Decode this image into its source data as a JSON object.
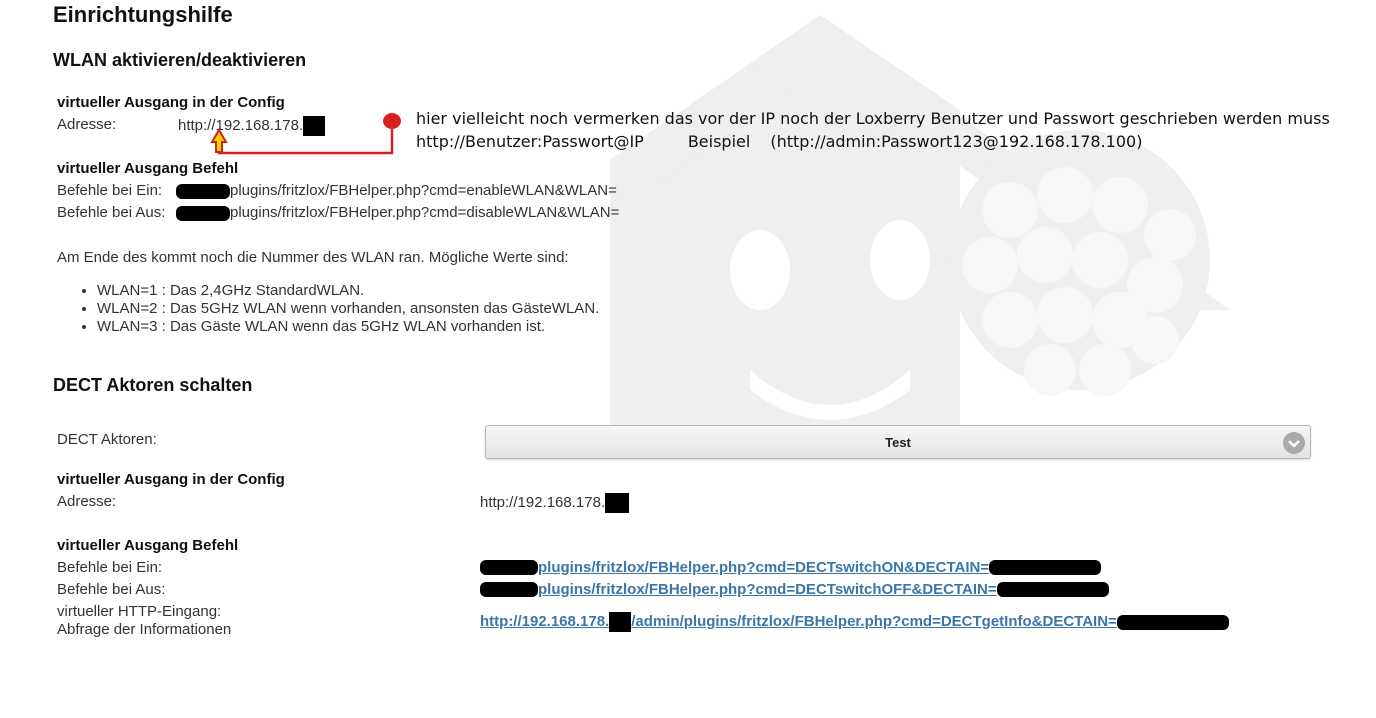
{
  "page": {
    "title": "Einrichtungshilfe"
  },
  "wlan": {
    "heading": "WLAN aktivieren/deaktivieren",
    "config_heading": "virtueller Ausgang in der Config",
    "address_label": "Adresse:",
    "address_value": "http://192.168.178.",
    "command_heading": "virtueller Ausgang Befehl",
    "on_label": "Befehle bei Ein:",
    "on_value": "plugins/fritzlox/FBHelper.php?cmd=enableWLAN&WLAN=",
    "off_label": "Befehle bei Aus:",
    "off_value": "plugins/fritzlox/FBHelper.php?cmd=disableWLAN&WLAN=",
    "info_text": "Am Ende des kommt noch die Nummer des WLAN ran. Mögliche Werte sind:",
    "options": [
      "WLAN=1 : Das 2,4GHz StandardWLAN.",
      "WLAN=2 : Das 5GHz WLAN wenn vorhanden, ansonsten das GästeWLAN.",
      "WLAN=3 : Das Gäste WLAN wenn das 5GHz WLAN vorhanden ist."
    ]
  },
  "annotation": {
    "line1": "hier vielleicht noch vermerken das vor der IP noch der Loxberry Benutzer und Passwort geschrieben werden muss",
    "line2_part1": "http://Benutzer:Passwort@IP",
    "line2_part2": "Beispiel",
    "line2_part3": "(http://admin:Passwort123@192.168.178.100)",
    "color": "#d42020"
  },
  "dect": {
    "heading": "DECT Aktoren schalten",
    "actors_label": "DECT Aktoren:",
    "actors_selected": "Test",
    "config_heading": "virtueller Ausgang in der Config",
    "address_label": "Adresse:",
    "address_value": "http://192.168.178.",
    "command_heading": "virtueller Ausgang Befehl",
    "on_label": "Befehle bei Ein:",
    "on_link": "plugins/fritzlox/FBHelper.php?cmd=DECTswitchON&DECTAIN=",
    "off_label": "Befehle bei Aus:",
    "off_link": "plugins/fritzlox/FBHelper.php?cmd=DECTswitchOFF&DECTAIN=",
    "http_in_label_1": "virtueller HTTP-Eingang:",
    "http_in_label_2": "Abfrage der Informationen",
    "info_link_part1": "http://192.168.178.",
    "info_link_part2": "/admin/plugins/fritzlox/FBHelper.php?cmd=DECTgetInfo&DECTAIN=",
    "link_color": "#3b76a8"
  }
}
